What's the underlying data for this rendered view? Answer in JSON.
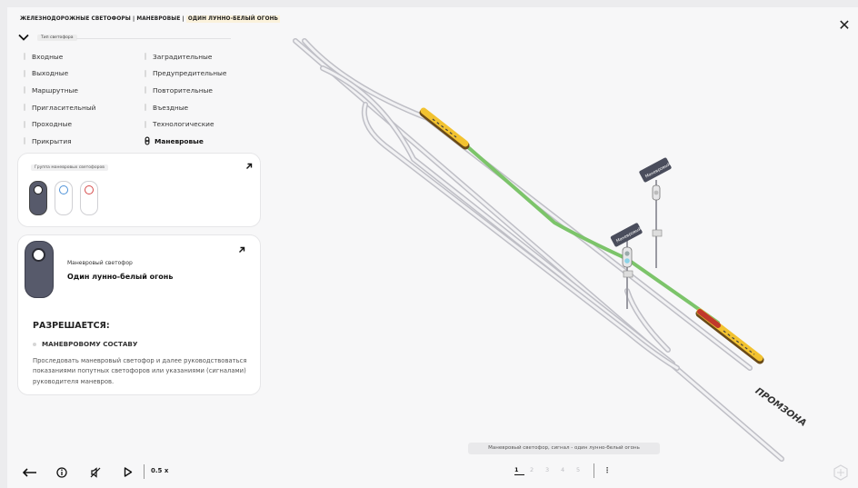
{
  "header": {
    "breadcrumb_a": "ЖЕЛЕЗНОДОРОЖНЫЕ СВЕТОФОРЫ",
    "breadcrumb_b": "МАНЕВРОВЫЕ",
    "breadcrumb_c": "ОДИН ЛУННО-БЕЛЫЙ ОГОНЬ",
    "separator": "|",
    "close_glyph": "✕"
  },
  "type_selector": {
    "label": "Тип светофора",
    "col1": [
      "Входные",
      "Выходные",
      "Маршрутные",
      "Пригласительный",
      "Проходные",
      "Прикрытия"
    ],
    "col2": [
      "Заградительные",
      "Предупредительные",
      "Повторительные",
      "Въездные",
      "Технологические",
      "Маневровые"
    ],
    "active": "Маневровые"
  },
  "group_card": {
    "title": "Группа маневровых светофоров",
    "variants": [
      "white",
      "blue",
      "red"
    ],
    "colors": {
      "dark": "#575a6b",
      "blue": "#4e92d8",
      "red": "#d64b4b"
    }
  },
  "info_card": {
    "subtitle": "Маневровый светофор",
    "name": "Один лунно-белый огонь",
    "allowed_heading": "РАЗРЕШАЕТСЯ:",
    "allowed_to": "МАНЕВРОВОМУ СОСТАВУ",
    "description": "Проследовать маневровый светофор и далее руководствоваться показаниями попутных светофоров или указаниями (сигналами) руководителя маневров."
  },
  "scene": {
    "signal_label": "Маневровый",
    "zone_label": "ПРОМЗОНА",
    "route_color": "#7cc46a",
    "train_color": "#f2c230",
    "lamp_color": "#8ad3e8"
  },
  "caption": "Маневровый светофор, сигнал - один лунно-белый огонь",
  "controls": {
    "back_icon": "back-arrow-icon",
    "info_icon": "info-icon",
    "sound_icon": "sound-off-icon",
    "play_icon": "play-icon",
    "speed": "0.5 x"
  },
  "pager": {
    "pages": [
      "1",
      "2",
      "3",
      "4",
      "5"
    ],
    "current": "1",
    "more_glyph": "⋮"
  }
}
